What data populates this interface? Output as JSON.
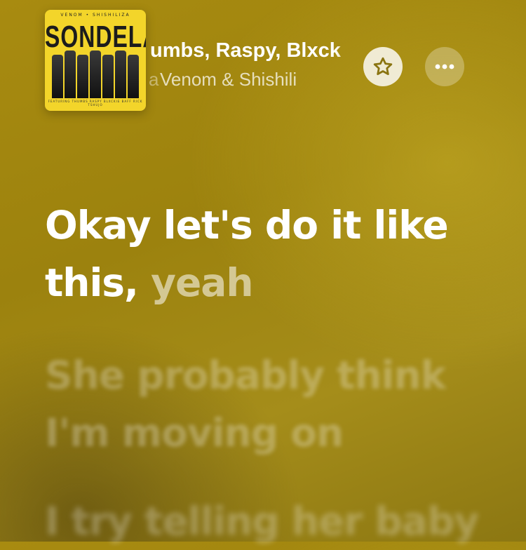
{
  "track": {
    "artwork": {
      "top_text": "VENOM • SHISHILIZA",
      "title": "SONDELA",
      "featuring": "FEATURING  THUMBS  RASPY  BLXCKIE  BAFF RICK  TSHUJO"
    },
    "title": "umbs, Raspy, Blxck",
    "artist": "Venom & Shishili",
    "artist_prefix": "a"
  },
  "controls": {
    "favorite_icon": "star-icon",
    "more_icon": "ellipsis-icon"
  },
  "lyrics": {
    "previous": "",
    "active_sung": "Okay let's do it like this,",
    "active_unsung": " yeah",
    "next": "She probably think I'm moving on",
    "next2": "I try telling her baby"
  },
  "colors": {
    "background": "#9c820e",
    "artwork_bg": "#f3d52a"
  }
}
